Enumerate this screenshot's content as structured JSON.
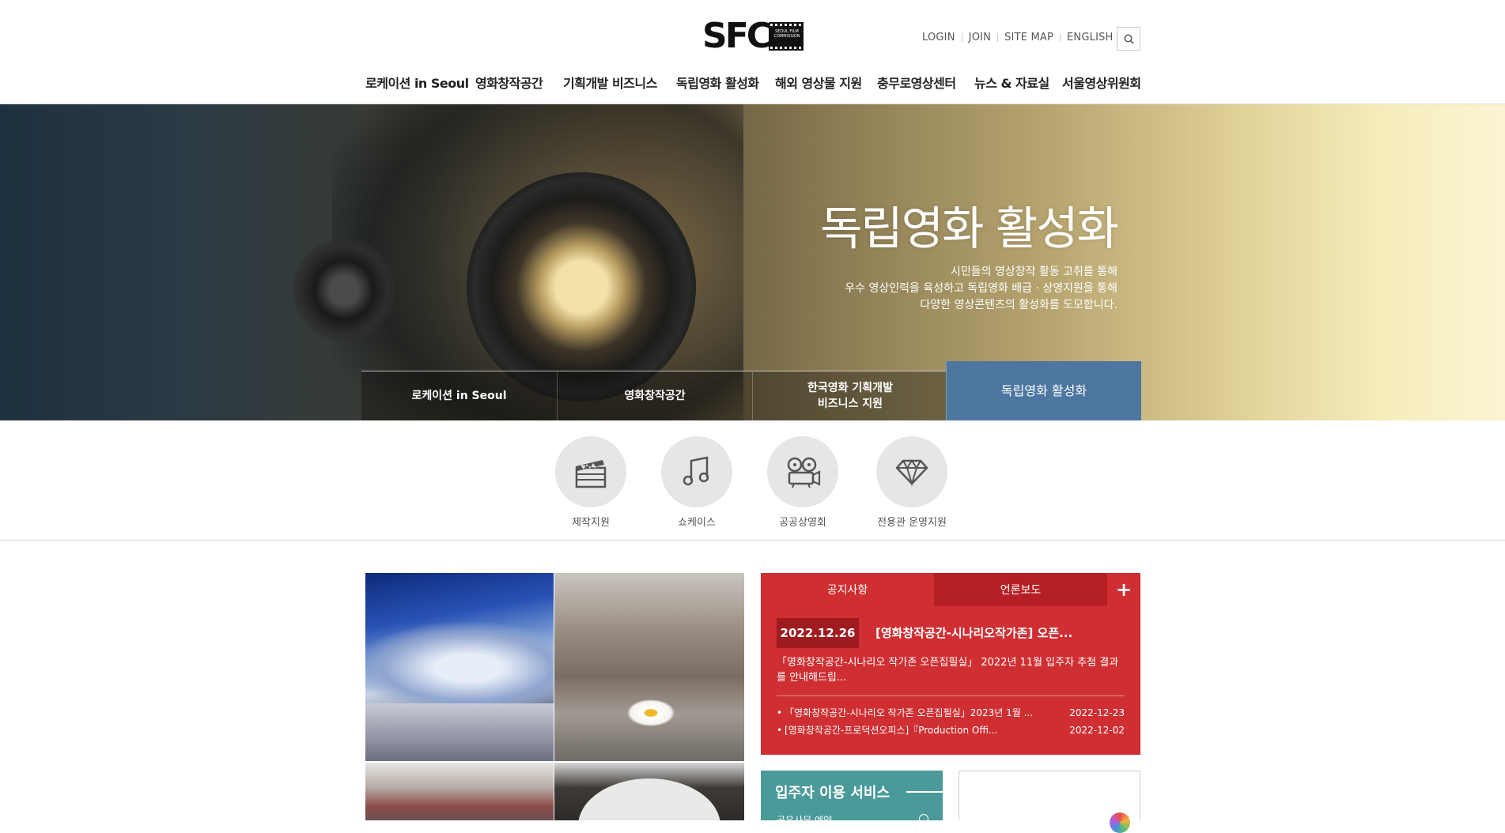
{
  "header": {
    "logo_text": "SFC",
    "logo_sub": "SEOUL FILM COMMISSION",
    "util_links": [
      "LOGIN",
      "JOIN",
      "SITE MAP",
      "ENGLISH"
    ],
    "search_icon": "search-icon"
  },
  "gnb": {
    "items": [
      "로케이션 in Seoul",
      "영화창작공간",
      "기획개발 비즈니스",
      "독립영화 활성화",
      "해외 영상물 지원",
      "충무로영상센터",
      "뉴스 & 자료실",
      "서울영상위원회"
    ]
  },
  "hero": {
    "title": "독립영화 활성화",
    "desc_lines": [
      "시민들의 영상창작 활동 고취를 통해",
      "우수 영상인력을 육성하고 독립영화 배급 · 상영지원을 통해",
      "다양한 영상콘텐츠의 활성화를 도모합니다."
    ],
    "tabs": [
      "로케이션 in Seoul",
      "영화창작공간",
      "한국영화 기획개발\n비즈니스 지원",
      "독립영화 활성화"
    ],
    "active_tab": 3
  },
  "services": [
    {
      "label": "제작지원",
      "icon": "clapperboard-icon"
    },
    {
      "label": "쇼케이스",
      "icon": "music-note-icon"
    },
    {
      "label": "공공상영회",
      "icon": "film-projector-icon"
    },
    {
      "label": "전용관 운영지원",
      "icon": "diamond-icon"
    }
  ],
  "board": {
    "tabs": [
      "공지사항",
      "언론보도"
    ],
    "more_label": "+",
    "featured": {
      "date": "2022.12.26",
      "title": "[영화창작공간-시나리오작가존] 오픈...",
      "summary": "「영화창작공간-시나리오 작가존 오픈집필실」 2022년 11월 입주자 추첨 결과 를 안내해드립..."
    },
    "items": [
      {
        "title": "「영화창작공간-시나리오 작가존 오픈집필실」2023년 1월 ...",
        "date": "2022-12-23"
      },
      {
        "title": "[영화창작공간-프로덕션오피스]『Production Offi...",
        "date": "2022-12-02"
      }
    ]
  },
  "service_box": {
    "title": "입주자 이용 서비스",
    "item": "공유사무 예약"
  },
  "colors": {
    "board_red": "#cf2f32",
    "board_dark_red": "#b51f24",
    "active_tab_blue": "#4d77a0",
    "service_teal": "#4b9a9a"
  }
}
